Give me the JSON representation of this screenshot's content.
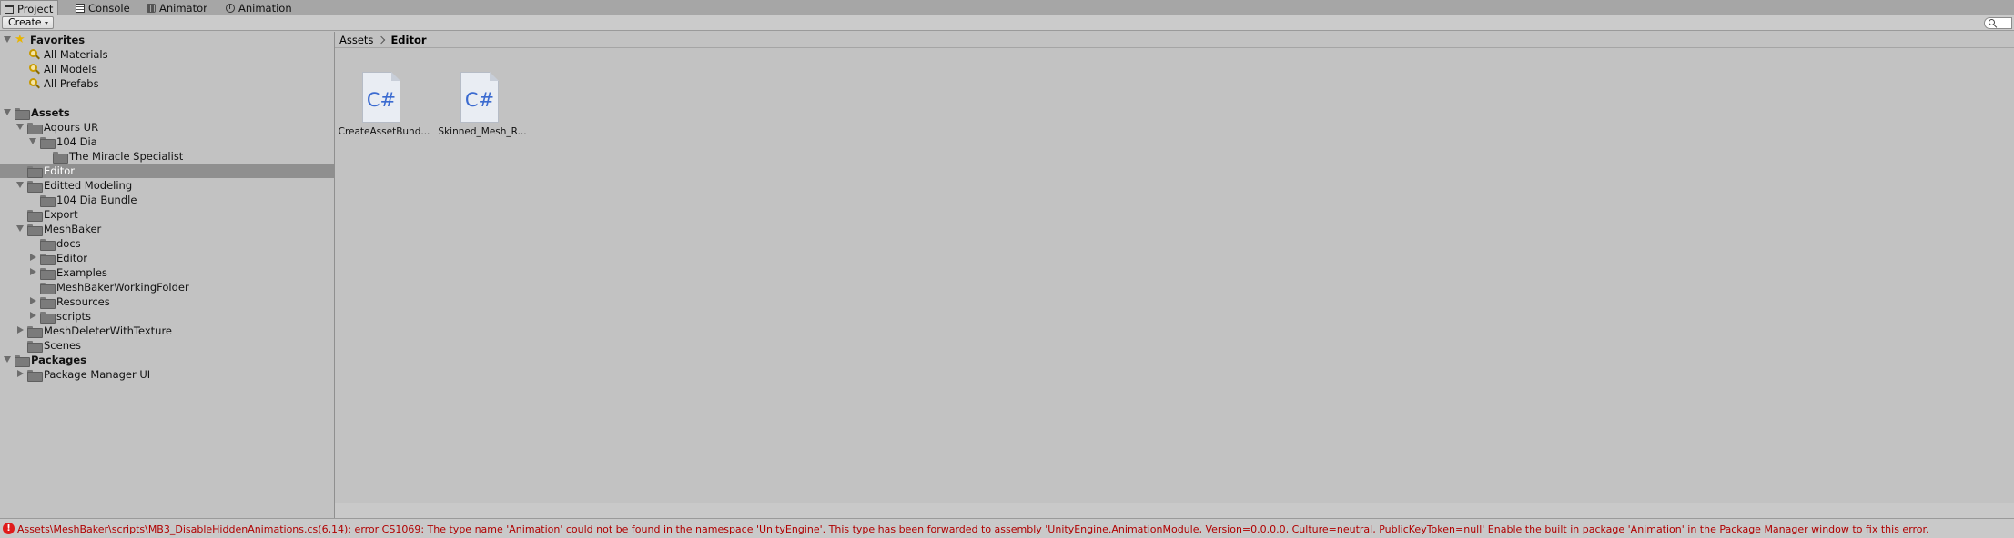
{
  "tabs": [
    {
      "label": "Project",
      "icon": "project-icon",
      "active": true
    },
    {
      "label": "Console",
      "icon": "console-icon",
      "active": false
    },
    {
      "label": "Animator",
      "icon": "animator-icon",
      "active": false
    },
    {
      "label": "Animation",
      "icon": "animation-icon",
      "active": false
    }
  ],
  "toolbar": {
    "create_label": "Create",
    "search_icon": "search-icon"
  },
  "tree": {
    "favorites": {
      "label": "Favorites",
      "items": [
        "All Materials",
        "All Models",
        "All Prefabs"
      ]
    },
    "assets": {
      "label": "Assets",
      "items": [
        {
          "label": "Aqours UR",
          "expanded": true
        },
        {
          "label": "104 Dia",
          "expanded": true
        },
        {
          "label": "The Miracle Specialist"
        },
        {
          "label": "Editor",
          "selected": true
        },
        {
          "label": "Editted Modeling",
          "expanded": true
        },
        {
          "label": "104 Dia Bundle"
        },
        {
          "label": "Export"
        },
        {
          "label": "MeshBaker",
          "expanded": true
        },
        {
          "label": "docs"
        },
        {
          "label": "Editor",
          "expanded": false
        },
        {
          "label": "Examples",
          "expanded": false
        },
        {
          "label": "MeshBakerWorkingFolder"
        },
        {
          "label": "Resources",
          "expanded": false
        },
        {
          "label": "scripts",
          "expanded": false
        },
        {
          "label": "MeshDeleterWithTexture",
          "expanded": false
        },
        {
          "label": "Scenes"
        }
      ]
    },
    "packages": {
      "label": "Packages",
      "items": [
        {
          "label": "Package Manager UI",
          "expanded": false
        }
      ]
    }
  },
  "breadcrumb": {
    "root": "Assets",
    "current": "Editor"
  },
  "files": [
    {
      "name": "CreateAssetBund...",
      "glyph": "C#"
    },
    {
      "name": "Skinned_Mesh_R...",
      "glyph": "C#"
    }
  ],
  "status": {
    "error_glyph": "!",
    "message": "Assets\\MeshBaker\\scripts\\MB3_DisableHiddenAnimations.cs(6,14): error CS1069: The type name 'Animation' could not be found in the namespace 'UnityEngine'. This type has been forwarded to assembly 'UnityEngine.AnimationModule, Version=0.0.0.0, Culture=neutral, PublicKeyToken=null' Enable the built in package 'Animation' in the Package Manager window to fix this error."
  },
  "colors": {
    "selection": "#8f8f8f",
    "error_text": "#b00000",
    "panel_bg": "#c2c2c2",
    "csharp": "#3b6bd0"
  }
}
